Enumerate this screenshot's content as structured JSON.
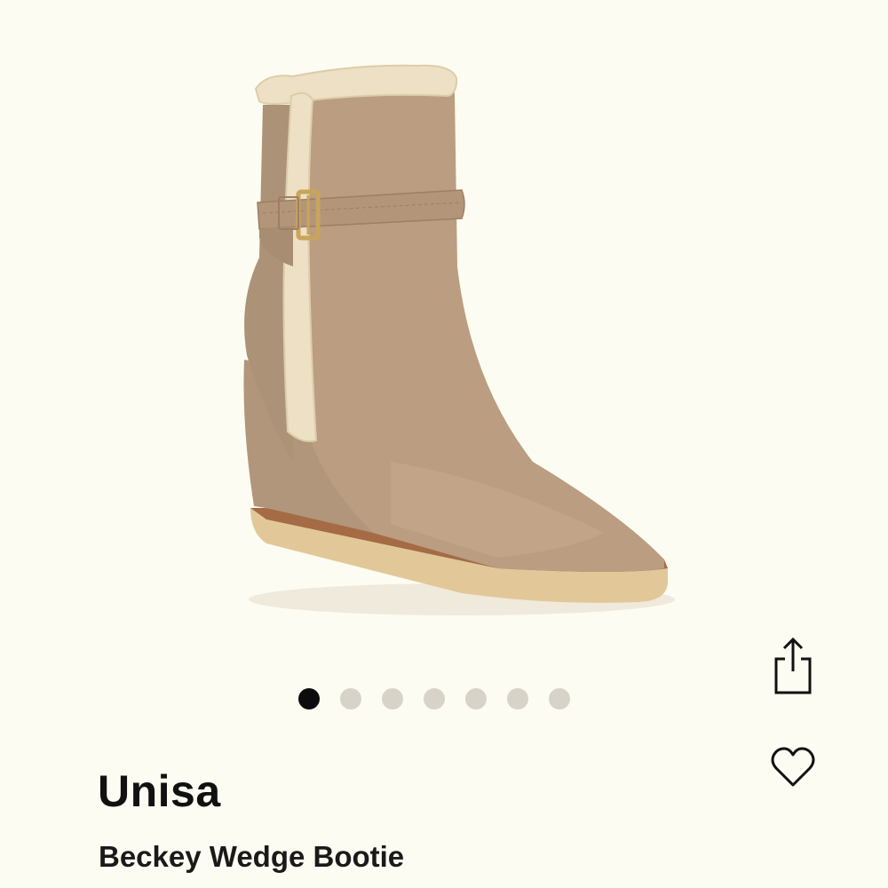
{
  "product": {
    "brand": "Unisa",
    "name": "Beckey Wedge Bootie",
    "image_alt": "Taupe suede wedge bootie with shearling trim and buckle strap"
  },
  "carousel": {
    "total": 7,
    "active_index": 0
  },
  "actions": {
    "share_icon": "share-icon",
    "favorite_icon": "heart-outline-icon"
  },
  "colors": {
    "background": "#fdfcf2",
    "dot_active": "#0c0c0c",
    "dot_inactive": "#d8d3c8",
    "boot_suede": "#b89a7d",
    "shearling": "#ede0c4",
    "sole": "#e0c597"
  }
}
